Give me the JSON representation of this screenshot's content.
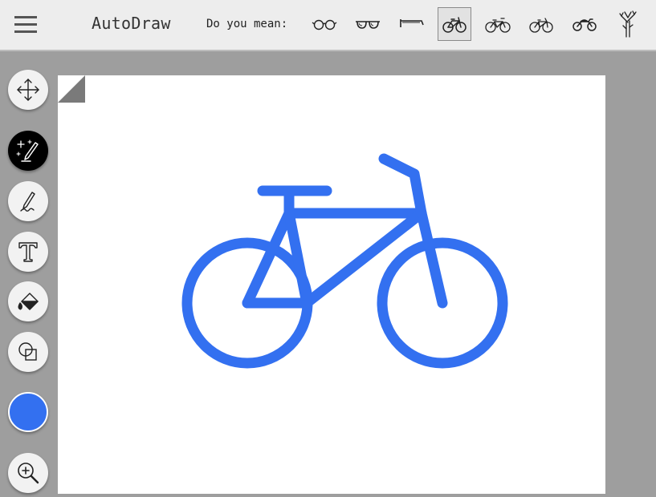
{
  "header": {
    "title": "AutoDraw",
    "prompt": "Do you mean:",
    "suggestions": [
      {
        "name": "glasses",
        "icon": "glasses-icon",
        "selected": false
      },
      {
        "name": "sunglasses",
        "icon": "sunglasses-icon",
        "selected": false
      },
      {
        "name": "eyeglasses side",
        "icon": "eyeglasses-side-icon",
        "selected": false
      },
      {
        "name": "bicycle",
        "icon": "bicycle-icon",
        "selected": true
      },
      {
        "name": "bicycle 2",
        "icon": "bicycle-icon",
        "selected": false
      },
      {
        "name": "bicycle 3",
        "icon": "bicycle-icon",
        "selected": false
      },
      {
        "name": "motorcycle",
        "icon": "motorcycle-icon",
        "selected": false
      },
      {
        "name": "tree",
        "icon": "tree-icon",
        "selected": false
      }
    ]
  },
  "toolbar": {
    "tools": [
      {
        "name": "select",
        "icon": "move-arrows-icon",
        "active": false
      },
      {
        "name": "autodraw",
        "icon": "autodraw-sparkle-pencil-icon",
        "active": true
      },
      {
        "name": "draw",
        "icon": "pencil-icon",
        "active": false
      },
      {
        "name": "type",
        "icon": "text-t-icon",
        "active": false
      },
      {
        "name": "fill",
        "icon": "paint-bucket-icon",
        "active": false
      },
      {
        "name": "shape",
        "icon": "shapes-icon",
        "active": false
      },
      {
        "name": "zoom",
        "icon": "zoom-in-icon",
        "active": false
      }
    ],
    "current_color": "#3370f0"
  },
  "canvas": {
    "drawing": "bicycle",
    "stroke_color": "#3370f0"
  },
  "colors": {
    "accent": "#3370f0",
    "topbar": "#ededed",
    "workspace": "#9e9e9e"
  }
}
